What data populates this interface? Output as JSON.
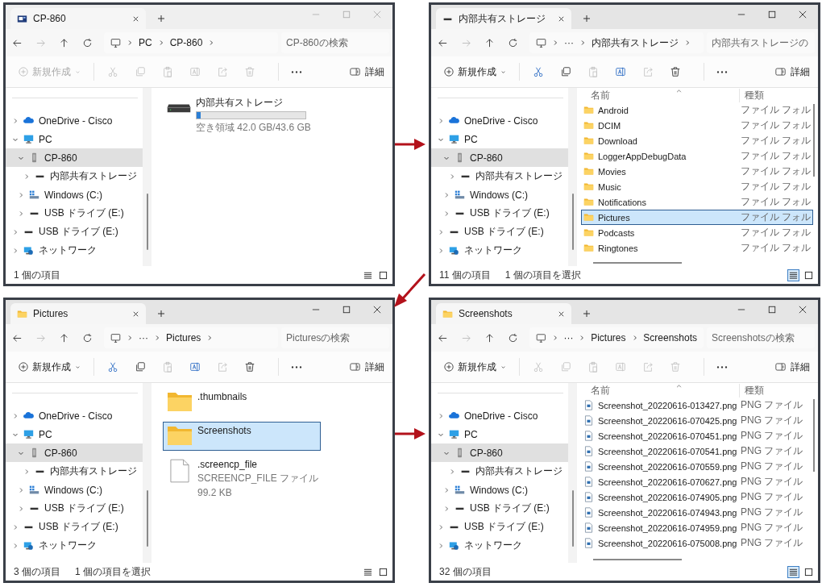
{
  "windows": [
    {
      "active": false,
      "tab": {
        "kind": "device",
        "title": "CP-860"
      },
      "nav": {
        "forward_enabled": false
      },
      "address": {
        "crumbs": [
          "PC",
          "CP-860"
        ],
        "trailing_chevron": true
      },
      "search": {
        "placeholder": "CP-860の検索"
      },
      "toolbar": {
        "new_label": "新規作成",
        "new_disabled": true,
        "tools": [
          {
            "kind": "cut",
            "disabled": true
          },
          {
            "kind": "copy",
            "disabled": true
          },
          {
            "kind": "paste",
            "disabled": true
          },
          {
            "kind": "rename",
            "disabled": true
          },
          {
            "kind": "share",
            "disabled": true
          },
          {
            "kind": "delete",
            "disabled": true
          }
        ],
        "details_label": "詳細"
      },
      "sidebar": [
        {
          "kind": "cloud",
          "label": "OneDrive - Cisco",
          "expanded": false,
          "selected": false
        },
        {
          "kind": "pc",
          "label": "PC",
          "expanded": true,
          "selected": false,
          "children": [
            {
              "kind": "device",
              "label": "CP-860",
              "expanded": true,
              "selected": true,
              "children": [
                {
                  "kind": "drive",
                  "label": "内部共有ストレージ",
                  "expanded": false,
                  "selected": false
                }
              ]
            },
            {
              "kind": "windows-drive",
              "label": "Windows (C:)",
              "expanded": false,
              "selected": false
            },
            {
              "kind": "drive",
              "label": "USB ドライブ (E:)",
              "expanded": false,
              "selected": false
            }
          ]
        },
        {
          "kind": "drive",
          "label": "USB ドライブ (E:)",
          "expanded": false,
          "selected": false
        },
        {
          "kind": "network",
          "label": "ネットワーク",
          "expanded": false,
          "selected": false
        }
      ],
      "content": {
        "kind": "tiles",
        "items": [
          {
            "kind": "drive",
            "name": "内部共有ストレージ",
            "level": 0.04,
            "detail": "空き領域 42.0 GB/43.6 GB",
            "selected": false
          }
        ]
      },
      "status": [
        "1 個の項目"
      ],
      "views": [
        {
          "kind": "details",
          "selected": false
        },
        {
          "kind": "tiles",
          "selected": false
        }
      ]
    },
    {
      "active": true,
      "tab": {
        "kind": "drive",
        "title": "内部共有ストレージ"
      },
      "nav": {
        "forward_enabled": false
      },
      "address": {
        "crumbs": [
          "···",
          "内部共有ストレージ"
        ],
        "trailing_chevron": true
      },
      "search": {
        "placeholder": "内部共有ストレージの"
      },
      "toolbar": {
        "new_label": "新規作成",
        "new_disabled": false,
        "tools": [
          {
            "kind": "cut",
            "disabled": false
          },
          {
            "kind": "copy",
            "disabled": false
          },
          {
            "kind": "paste",
            "disabled": true
          },
          {
            "kind": "rename",
            "disabled": false
          },
          {
            "kind": "share",
            "disabled": true
          },
          {
            "kind": "delete",
            "disabled": false
          }
        ],
        "details_label": "詳細"
      },
      "sidebar": [
        {
          "kind": "cloud",
          "label": "OneDrive - Cisco",
          "expanded": false,
          "selected": false
        },
        {
          "kind": "pc",
          "label": "PC",
          "expanded": true,
          "selected": false,
          "children": [
            {
              "kind": "device",
              "label": "CP-860",
              "expanded": true,
              "selected": true,
              "children": [
                {
                  "kind": "drive",
                  "label": "内部共有ストレージ",
                  "expanded": false,
                  "selected": false
                }
              ]
            },
            {
              "kind": "windows-drive",
              "label": "Windows (C:)",
              "expanded": false,
              "selected": false
            },
            {
              "kind": "drive",
              "label": "USB ドライブ (E:)",
              "expanded": false,
              "selected": false
            }
          ]
        },
        {
          "kind": "drive",
          "label": "USB ドライブ (E:)",
          "expanded": false,
          "selected": false
        },
        {
          "kind": "network",
          "label": "ネットワーク",
          "expanded": false,
          "selected": false
        }
      ],
      "content": {
        "kind": "details",
        "columns": [
          "名前",
          "種類"
        ],
        "sorted": true,
        "rows": [
          {
            "kind": "folder",
            "name": "Android",
            "type": "ファイル フォル",
            "selected": false
          },
          {
            "kind": "folder",
            "name": "DCIM",
            "type": "ファイル フォル",
            "selected": false
          },
          {
            "kind": "folder",
            "name": "Download",
            "type": "ファイル フォル",
            "selected": false
          },
          {
            "kind": "folder",
            "name": "LoggerAppDebugData",
            "type": "ファイル フォル",
            "selected": false
          },
          {
            "kind": "folder",
            "name": "Movies",
            "type": "ファイル フォル",
            "selected": false
          },
          {
            "kind": "folder",
            "name": "Music",
            "type": "ファイル フォル",
            "selected": false
          },
          {
            "kind": "folder",
            "name": "Notifications",
            "type": "ファイル フォル",
            "selected": false
          },
          {
            "kind": "folder",
            "name": "Pictures",
            "type": "ファイル フォル",
            "selected": true
          },
          {
            "kind": "folder",
            "name": "Podcasts",
            "type": "ファイル フォル",
            "selected": false
          },
          {
            "kind": "folder",
            "name": "Ringtones",
            "type": "ファイル フォル",
            "selected": false
          }
        ]
      },
      "status": [
        "11 個の項目",
        "1 個の項目を選択"
      ],
      "views": [
        {
          "kind": "details",
          "selected": true
        },
        {
          "kind": "tiles",
          "selected": false
        }
      ]
    },
    {
      "active": true,
      "tab": {
        "kind": "folder",
        "title": "Pictures"
      },
      "nav": {
        "forward_enabled": false
      },
      "address": {
        "crumbs": [
          "···",
          "Pictures"
        ],
        "trailing_chevron": true
      },
      "search": {
        "placeholder": "Picturesの検索"
      },
      "toolbar": {
        "new_label": "新規作成",
        "new_disabled": false,
        "tools": [
          {
            "kind": "cut",
            "disabled": false
          },
          {
            "kind": "copy",
            "disabled": false
          },
          {
            "kind": "paste",
            "disabled": true
          },
          {
            "kind": "rename",
            "disabled": false
          },
          {
            "kind": "share",
            "disabled": true
          },
          {
            "kind": "delete",
            "disabled": false
          }
        ],
        "details_label": "詳細"
      },
      "sidebar": [
        {
          "kind": "cloud",
          "label": "OneDrive - Cisco",
          "expanded": false,
          "selected": false
        },
        {
          "kind": "pc",
          "label": "PC",
          "expanded": true,
          "selected": false,
          "children": [
            {
              "kind": "device",
              "label": "CP-860",
              "expanded": true,
              "selected": true,
              "children": [
                {
                  "kind": "drive",
                  "label": "内部共有ストレージ",
                  "expanded": false,
                  "selected": false
                }
              ]
            },
            {
              "kind": "windows-drive",
              "label": "Windows (C:)",
              "expanded": false,
              "selected": false
            },
            {
              "kind": "drive",
              "label": "USB ドライブ (E:)",
              "expanded": false,
              "selected": false
            }
          ]
        },
        {
          "kind": "drive",
          "label": "USB ドライブ (E:)",
          "expanded": false,
          "selected": false
        },
        {
          "kind": "network",
          "label": "ネットワーク",
          "expanded": false,
          "selected": false
        }
      ],
      "content": {
        "kind": "tiles",
        "items": [
          {
            "kind": "folder",
            "name": ".thumbnails",
            "selected": false
          },
          {
            "kind": "folder",
            "name": "Screenshots",
            "selected": true
          },
          {
            "kind": "file",
            "name": ".screencp_file",
            "lines": [
              "SCREENCP_FILE ファイル",
              "99.2 KB"
            ],
            "selected": false
          }
        ]
      },
      "status": [
        "3 個の項目",
        "1 個の項目を選択"
      ],
      "views": [
        {
          "kind": "details",
          "selected": false
        },
        {
          "kind": "tiles",
          "selected": false
        }
      ]
    },
    {
      "active": true,
      "tab": {
        "kind": "folder",
        "title": "Screenshots"
      },
      "nav": {
        "forward_enabled": false
      },
      "address": {
        "crumbs": [
          "···",
          "Pictures",
          "Screenshots"
        ],
        "trailing_chevron": false
      },
      "search": {
        "placeholder": "Screenshotsの検索"
      },
      "toolbar": {
        "new_label": "新規作成",
        "new_disabled": false,
        "tools": [
          {
            "kind": "cut",
            "disabled": true
          },
          {
            "kind": "copy",
            "disabled": true
          },
          {
            "kind": "paste",
            "disabled": true
          },
          {
            "kind": "rename",
            "disabled": true
          },
          {
            "kind": "share",
            "disabled": true
          },
          {
            "kind": "delete",
            "disabled": true
          }
        ],
        "details_label": "詳細"
      },
      "sidebar": [
        {
          "kind": "cloud",
          "label": "OneDrive - Cisco",
          "expanded": false,
          "selected": false
        },
        {
          "kind": "pc",
          "label": "PC",
          "expanded": true,
          "selected": false,
          "children": [
            {
              "kind": "device",
              "label": "CP-860",
              "expanded": true,
              "selected": true,
              "children": [
                {
                  "kind": "drive",
                  "label": "内部共有ストレージ",
                  "expanded": false,
                  "selected": false
                }
              ]
            },
            {
              "kind": "windows-drive",
              "label": "Windows (C:)",
              "expanded": false,
              "selected": false
            },
            {
              "kind": "drive",
              "label": "USB ドライブ (E:)",
              "expanded": false,
              "selected": false
            }
          ]
        },
        {
          "kind": "drive",
          "label": "USB ドライブ (E:)",
          "expanded": false,
          "selected": false
        },
        {
          "kind": "network",
          "label": "ネットワーク",
          "expanded": false,
          "selected": false
        }
      ],
      "content": {
        "kind": "details",
        "columns": [
          "名前",
          "種類"
        ],
        "sorted": true,
        "rows": [
          {
            "kind": "image-file",
            "name": "Screenshot_20220616-013427.png",
            "type": "PNG ファイル",
            "selected": false
          },
          {
            "kind": "image-file",
            "name": "Screenshot_20220616-070425.png",
            "type": "PNG ファイル",
            "selected": false
          },
          {
            "kind": "image-file",
            "name": "Screenshot_20220616-070451.png",
            "type": "PNG ファイル",
            "selected": false
          },
          {
            "kind": "image-file",
            "name": "Screenshot_20220616-070541.png",
            "type": "PNG ファイル",
            "selected": false
          },
          {
            "kind": "image-file",
            "name": "Screenshot_20220616-070559.png",
            "type": "PNG ファイル",
            "selected": false
          },
          {
            "kind": "image-file",
            "name": "Screenshot_20220616-070627.png",
            "type": "PNG ファイル",
            "selected": false
          },
          {
            "kind": "image-file",
            "name": "Screenshot_20220616-074905.png",
            "type": "PNG ファイル",
            "selected": false
          },
          {
            "kind": "image-file",
            "name": "Screenshot_20220616-074943.png",
            "type": "PNG ファイル",
            "selected": false
          },
          {
            "kind": "image-file",
            "name": "Screenshot_20220616-074959.png",
            "type": "PNG ファイル",
            "selected": false
          },
          {
            "kind": "image-file",
            "name": "Screenshot_20220616-075008.png",
            "type": "PNG ファイル",
            "selected": false
          }
        ]
      },
      "status": [
        "32 個の項目"
      ],
      "views": [
        {
          "kind": "details",
          "selected": true
        },
        {
          "kind": "tiles",
          "selected": false
        }
      ]
    }
  ]
}
